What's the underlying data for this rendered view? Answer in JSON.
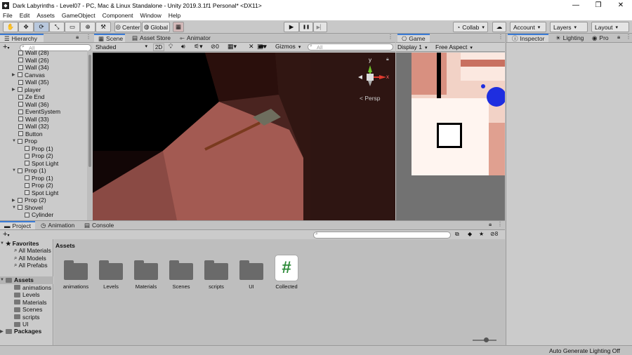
{
  "window": {
    "title": "Dark Labyrinths - Level07 - PC, Mac & Linux Standalone - Unity 2019.3.1f1 Personal* <DX11>",
    "min": "—",
    "max": "❐",
    "close": "✕"
  },
  "menu": [
    "File",
    "Edit",
    "Assets",
    "GameObject",
    "Component",
    "Window",
    "Help"
  ],
  "toolbar": {
    "center": "Center",
    "global": "Global",
    "play": "▶",
    "pause": "❚❚",
    "step": "▶▏",
    "collab": "Collab",
    "account": "Account",
    "layers": "Layers",
    "layout": "Layout"
  },
  "hierarchy": {
    "tab": "Hierarchy",
    "search_placeholder": "All",
    "items": [
      {
        "label": "Wall (28)",
        "indent": 0,
        "arrow": false
      },
      {
        "label": "Wall (26)",
        "indent": 0,
        "arrow": false
      },
      {
        "label": "Wall (34)",
        "indent": 0,
        "arrow": false
      },
      {
        "label": "Canvas",
        "indent": 0,
        "arrow": true,
        "open": false
      },
      {
        "label": "Wall (35)",
        "indent": 0,
        "arrow": false
      },
      {
        "label": "player",
        "indent": 0,
        "arrow": true,
        "open": false
      },
      {
        "label": "Ze End",
        "indent": 0,
        "arrow": false
      },
      {
        "label": "Wall (36)",
        "indent": 0,
        "arrow": false
      },
      {
        "label": "EventSystem",
        "indent": 0,
        "arrow": false
      },
      {
        "label": "Wall (33)",
        "indent": 0,
        "arrow": false
      },
      {
        "label": "Wall (32)",
        "indent": 0,
        "arrow": false
      },
      {
        "label": "Button",
        "indent": 0,
        "arrow": false
      },
      {
        "label": "Prop",
        "indent": 0,
        "arrow": true,
        "open": true
      },
      {
        "label": "Prop (1)",
        "indent": 1,
        "arrow": false
      },
      {
        "label": "Prop (2)",
        "indent": 1,
        "arrow": false
      },
      {
        "label": "Spot Light",
        "indent": 1,
        "arrow": false
      },
      {
        "label": "Prop (1)",
        "indent": 0,
        "arrow": true,
        "open": true
      },
      {
        "label": "Prop (1)",
        "indent": 1,
        "arrow": false
      },
      {
        "label": "Prop (2)",
        "indent": 1,
        "arrow": false
      },
      {
        "label": "Spot Light",
        "indent": 1,
        "arrow": false
      },
      {
        "label": "Prop (2)",
        "indent": 0,
        "arrow": true,
        "open": false
      },
      {
        "label": "Shovel",
        "indent": 0,
        "arrow": true,
        "open": true
      },
      {
        "label": "Cylinder",
        "indent": 1,
        "arrow": false
      }
    ]
  },
  "scene": {
    "tabs": [
      "Scene",
      "Asset Store",
      "Animator"
    ],
    "shading": "Shaded",
    "mode_2d": "2D",
    "gizmos": "Gizmos",
    "search_placeholder": "All",
    "hidden_count": "0",
    "persp": "< Persp",
    "axis_y": "y",
    "axis_x": "x"
  },
  "game": {
    "tab": "Game",
    "display": "Display 1",
    "aspect": "Free Aspect"
  },
  "inspector": {
    "tabs": [
      "Inspector",
      "Lighting",
      "Pro"
    ]
  },
  "project": {
    "tabs": [
      "Project",
      "Animation",
      "Console"
    ],
    "favorites_label": "Favorites",
    "favorites": [
      "All Materials",
      "All Models",
      "All Prefabs"
    ],
    "assets_label": "Assets",
    "asset_folders": [
      "animations",
      "Levels",
      "Materials",
      "Scenes",
      "scripts",
      "UI"
    ],
    "packages_label": "Packages",
    "breadcrumb": "Assets",
    "grid_items": [
      {
        "label": "animations",
        "kind": "folder"
      },
      {
        "label": "Levels",
        "kind": "folder"
      },
      {
        "label": "Materials",
        "kind": "folder"
      },
      {
        "label": "Scenes",
        "kind": "folder"
      },
      {
        "label": "scripts",
        "kind": "folder"
      },
      {
        "label": "UI",
        "kind": "folder"
      },
      {
        "label": "Collected",
        "kind": "script"
      }
    ],
    "hidden_count": "8",
    "script_glyph": "#"
  },
  "status": {
    "text": "Auto Generate Lighting Off"
  },
  "colors": {
    "accent": "#3a7bd5",
    "script_green": "#2e8b3a"
  }
}
